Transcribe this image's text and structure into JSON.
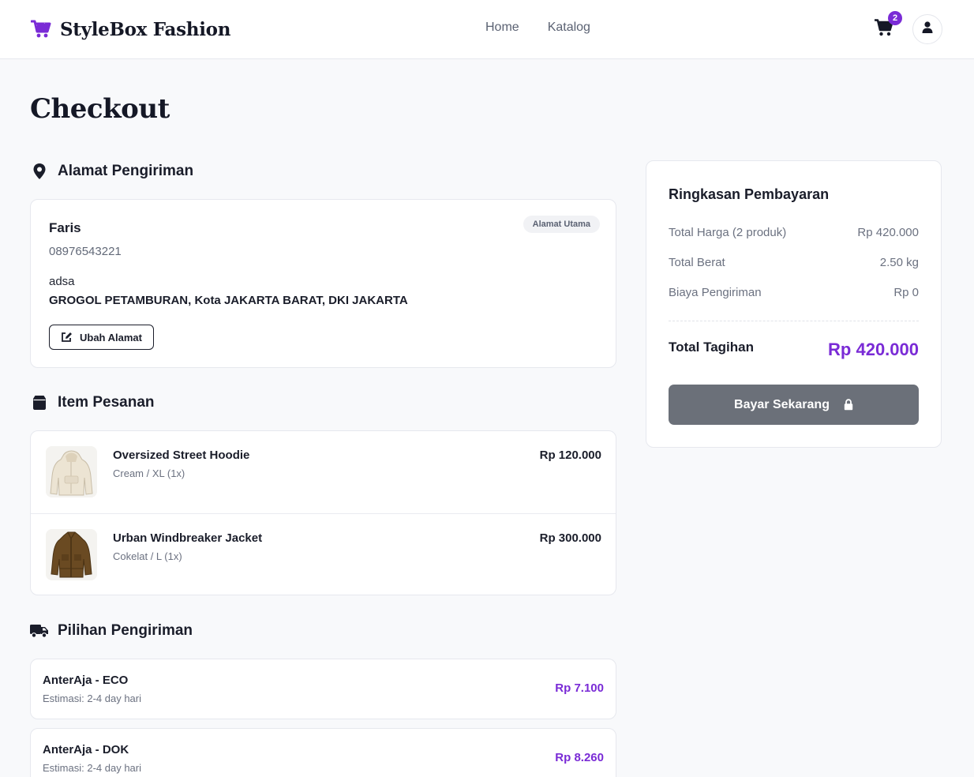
{
  "header": {
    "brand": "StyleBox Fashion",
    "nav": [
      "Home",
      "Katalog"
    ],
    "cart_count": "2",
    "accent": "#7a2bd6"
  },
  "page": {
    "title": "Checkout"
  },
  "address": {
    "section_title": "Alamat Pengiriman",
    "name": "Faris",
    "phone": "08976543221",
    "detail": "adsa",
    "full": "GROGOL PETAMBURAN, Kota JAKARTA BARAT, DKI JAKARTA",
    "badge": "Alamat Utama",
    "edit_label": "Ubah Alamat"
  },
  "items": {
    "section_title": "Item Pesanan",
    "list": [
      {
        "name": "Oversized Street Hoodie",
        "variant": "Cream / XL (1x)",
        "price": "Rp 120.000"
      },
      {
        "name": "Urban Windbreaker Jacket",
        "variant": "Cokelat / L (1x)",
        "price": "Rp 300.000"
      }
    ]
  },
  "shipping": {
    "section_title": "Pilihan Pengiriman",
    "options": [
      {
        "name": "AnterAja - ECO",
        "estimate": "Estimasi: 2-4 day hari",
        "price": "Rp 7.100"
      },
      {
        "name": "AnterAja - DOK",
        "estimate": "Estimasi: 2-4 day hari",
        "price": "Rp 8.260"
      }
    ]
  },
  "summary": {
    "title": "Ringkasan Pembayaran",
    "rows": [
      {
        "label": "Total Harga (2 produk)",
        "value": "Rp 420.000"
      },
      {
        "label": "Total Berat",
        "value": "2.50 kg"
      },
      {
        "label": "Biaya Pengiriman",
        "value": "Rp 0"
      }
    ],
    "total_label": "Total Tagihan",
    "total_value": "Rp 420.000",
    "pay_label": "Bayar Sekarang"
  }
}
